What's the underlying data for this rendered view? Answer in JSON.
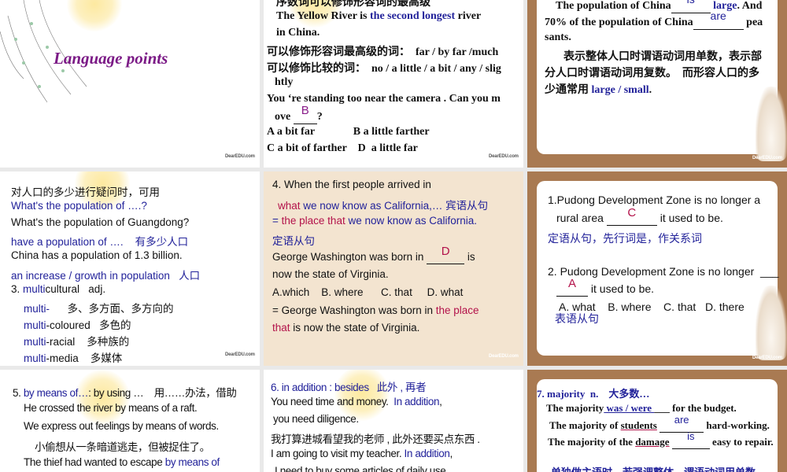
{
  "slides": [
    {
      "title": "Language points",
      "logo": "DearEDU.com",
      "lines": []
    },
    {
      "logo": "DearEDU.com",
      "lines": [
        [
          {
            "t": "序数词可以修饰形容词的最高级"
          }
        ],
        [
          {
            "t": "The Yellow River is "
          },
          {
            "t": "the second longest",
            "c": "blue"
          },
          {
            "t": " river"
          }
        ],
        [
          {
            "t": "in China."
          }
        ],
        [
          {
            "t": "可以修饰形容词最高级的词：  far / by far /much"
          }
        ],
        [
          {
            "t": "可以修饰比较的词：  no / a little / a bit / any / slig"
          }
        ],
        [
          {
            "t": "htly"
          }
        ],
        [
          {
            "t": "You ‘re standing too near the camera . Can you m"
          }
        ],
        [
          {
            "t": "ove "
          },
          {
            "a": "B",
            "c": "purple",
            "w": 30
          },
          {
            "t": "?"
          }
        ],
        [
          {
            "t": "A a bit far              B a little farther"
          }
        ],
        [
          {
            "t": "C a bit of farther    D  a little far"
          }
        ]
      ]
    },
    {
      "logo": "DearEDU.com",
      "lines": [
        [
          {
            "t": "The population of China"
          },
          {
            "a": "is",
            "c": "blue",
            "w": 50
          },
          {
            "t": " "
          },
          {
            "t": "large",
            "c": "blue"
          },
          {
            "t": ". And"
          }
        ],
        [
          {
            "t": "70% of the population of China"
          },
          {
            "a": "are",
            "c": "blue",
            "w": 64
          },
          {
            "t": " pea"
          }
        ],
        [
          {
            "t": "sants."
          }
        ],
        [
          {
            "t": "表示整体人口时谓语动词用单数，表示部"
          }
        ],
        [
          {
            "t": "分人口时谓语动词用复数。  而形容人口的多"
          }
        ],
        [
          {
            "t": "少通常用 "
          },
          {
            "t": "large / small",
            "c": "blue"
          },
          {
            "t": "."
          }
        ]
      ]
    },
    {
      "logo": "DearEDU.com",
      "lines": [
        [
          {
            "t": "对人口的多少进行疑问时，可用"
          }
        ],
        [
          {
            "t": "What's the population of ….?",
            "c": "blue"
          }
        ],
        [
          {
            "t": "What's the population of Guangdong?"
          }
        ],
        [
          {
            "t": "have a population of ….    有多少人口",
            "c": "blue"
          }
        ],
        [
          {
            "t": "China has a population of 1.3 billion."
          }
        ],
        [
          {
            "t": "an increase / growth in population   人口",
            "c": "blue"
          }
        ],
        [
          {
            "t": "3. "
          },
          {
            "t": "multi",
            "c": "blue"
          },
          {
            "t": "cultural   adj."
          }
        ],
        [
          {
            "t": "multi-",
            "c": "blue"
          },
          {
            "t": "      多、多方面、多方向的"
          }
        ],
        [
          {
            "t": "multi",
            "c": "blue"
          },
          {
            "t": "-coloured   多色的"
          }
        ],
        [
          {
            "t": "multi",
            "c": "blue"
          },
          {
            "t": "-racial    多种族的"
          }
        ],
        [
          {
            "t": "multi",
            "c": "blue"
          },
          {
            "t": "-media    多媒体"
          }
        ]
      ]
    },
    {
      "logo": "DearEDU.com",
      "lines": [
        [
          {
            "t": "4. When the first people arrived in"
          }
        ],
        [
          {
            "t": "what",
            "c": "red"
          },
          {
            "t": " we now know as California,… 宾语从句",
            "c": "blue"
          }
        ],
        [
          {
            "t": "= ",
            "c": "blue"
          },
          {
            "t": "the place that",
            "c": "red"
          },
          {
            "t": " we now know as California.",
            "c": "blue"
          }
        ],
        [
          {
            "t": "定语从句",
            "c": "blue"
          }
        ],
        [
          {
            "t": "George Washington was born in "
          },
          {
            "a": "D",
            "c": "red",
            "w": 48
          },
          {
            "t": " is"
          }
        ],
        [
          {
            "t": "now the state of Virginia."
          }
        ],
        [
          {
            "t": "A.which    B. where      C. that     D. what"
          }
        ],
        [
          {
            "t": "= George Washington was born in "
          },
          {
            "t": "the place",
            "c": "red"
          }
        ],
        [
          {
            "t": "that",
            "c": "red"
          },
          {
            "t": " is now the state of Virginia."
          }
        ]
      ]
    },
    {
      "logo": "DearEDU.com",
      "lines": [
        [
          {
            "t": "1.Pudong Development Zone is no longer a"
          }
        ],
        [
          {
            "t": "rural area "
          },
          {
            "a": "C",
            "c": "red",
            "w": 64
          },
          {
            "t": " it used to be."
          }
        ],
        [
          {
            "t": "定语从句，先行词是，作关系词",
            "c": "blue"
          }
        ],
        [
          {
            "t": "2. Pudong Development Zone is no longer  ___"
          }
        ],
        [
          {
            "a": "A",
            "c": "red",
            "w": 40
          },
          {
            "t": " it used to be."
          }
        ],
        [
          {
            "t": "A. what    B. where    C. that   D. there"
          }
        ],
        [
          {
            "t": "表语从句",
            "c": "blue"
          }
        ]
      ]
    },
    {
      "lines": [
        [
          {
            "t": "5. "
          },
          {
            "t": "by means of…",
            "c": "blue"
          },
          {
            "t": ": by using …    用……办法，借助"
          }
        ],
        [
          {
            "t": "He crossed the river by means of a raft."
          }
        ],
        [
          {
            "t": "We express out feelings by means of words."
          }
        ],
        [
          {
            "t": "小偷想从一条暗道逃走，但被捉住了。"
          }
        ],
        [
          {
            "t": "The thief had wanted to escape "
          },
          {
            "t": "by means of",
            "c": "blue"
          }
        ]
      ]
    },
    {
      "lines": [
        [
          {
            "t": "6. in addition : besides   此外 , 再者",
            "c": "blue"
          }
        ],
        [
          {
            "t": "You need time and money.  "
          },
          {
            "t": "In addition",
            "c": "blue"
          },
          {
            "t": ","
          }
        ],
        [
          {
            "t": "you need diligence."
          }
        ],
        [
          {
            "t": "我打算进城看望我的老师 , 此外还要买点东西 ."
          }
        ],
        [
          {
            "t": "I am going to visit my teacher. "
          },
          {
            "t": "In addition",
            "c": "blue"
          },
          {
            "t": ","
          }
        ],
        [
          {
            "t": "I need to buy some articles of daily use."
          }
        ]
      ]
    },
    {
      "lines": [
        [
          {
            "t": "7. majority  n.    大多数…",
            "c": "blue"
          }
        ],
        [
          {
            "t": "The majority"
          },
          {
            "t": " was / were ",
            "c": "blue",
            "u": true
          },
          {
            "t": "___ for the budget."
          }
        ],
        [
          {
            "t": "The majority of "
          },
          {
            "t": "students",
            "ul": true
          },
          {
            "t": " "
          },
          {
            "a": "are",
            "c": "blue",
            "w": 56
          },
          {
            "t": " hard-working."
          }
        ],
        [
          {
            "t": "The majority of the "
          },
          {
            "t": "damage",
            "ul": true
          },
          {
            "t": " "
          },
          {
            "a": "is",
            "c": "blue",
            "w": 48
          },
          {
            "t": " easy to repair."
          }
        ],
        [
          {
            "t": "单独做主语时，若强调整体，谓语动词用单数",
            "c": "blue"
          }
        ]
      ]
    }
  ]
}
